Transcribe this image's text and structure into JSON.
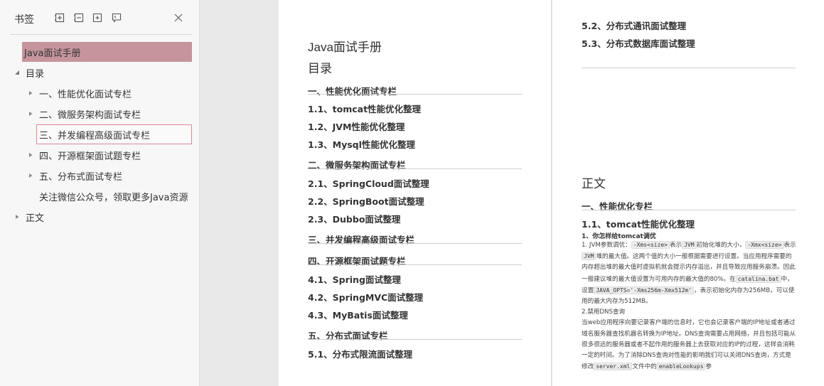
{
  "sidebar": {
    "title": "书签",
    "items": [
      {
        "label": "Java面试手册",
        "expandable": false
      },
      {
        "label": "目录",
        "expandable": true,
        "expanded": true
      },
      {
        "label": "一、性能优化面试专栏",
        "expandable": true,
        "expanded": false
      },
      {
        "label": "二、微服务架构面试专栏",
        "expandable": true,
        "expanded": false
      },
      {
        "label": "三、并发编程高级面试专栏",
        "expandable": false
      },
      {
        "label": "四、开源框架面试题专栏",
        "expandable": true,
        "expanded": false
      },
      {
        "label": "五、分布式面试专栏",
        "expandable": true,
        "expanded": false
      },
      {
        "label": "关注微信公众号，领取更多Java资源",
        "expandable": false
      },
      {
        "label": "正文",
        "expandable": true,
        "expanded": false
      }
    ]
  },
  "left_page": {
    "doc_title": "Java面试手册",
    "toc_title": "目录",
    "entries": [
      {
        "text": "一、性能优化面试专栏"
      },
      {
        "text": "1.1、tomcat性能优化整理"
      },
      {
        "text": "1.2、JVM性能优化整理"
      },
      {
        "text": "1.3、Mysql性能优化整理"
      },
      {
        "text": "二、微服务架构面试专栏"
      },
      {
        "text": "2.1、SpringCloud面试整理"
      },
      {
        "text": "2.2、SpringBoot面试整理"
      },
      {
        "text": "2.3、Dubbo面试整理"
      },
      {
        "text": "三、并发编程高级面试专栏"
      },
      {
        "text": "四、开源框架面试题专栏"
      },
      {
        "text": "4.1、Spring面试整理"
      },
      {
        "text": "4.2、SpringMVC面试整理"
      },
      {
        "text": "4.3、MyBatis面试整理"
      },
      {
        "text": "五、分布式面试专栏"
      },
      {
        "text": "5.1、分布式限流面试整理"
      }
    ]
  },
  "right_page": {
    "toc_continued": [
      "5.2、分布式通讯面试整理",
      "5.3、分布式数据库面试整理"
    ],
    "main_title": "正文",
    "section_heading": "一、性能优化专栏",
    "sub_heading": "1.1、tomcat性能优化整理",
    "q_heading": "1、你怎样给tomcat调优",
    "p1": {
      "a": "1. JVM参数调优：",
      "c1": "-Xms<size>",
      "b": "表示",
      "c2": "JVM",
      "d": "初始化堆的大小，",
      "c3": "-Xmx<size>",
      "e": "表示",
      "c4": "JVM",
      "f": "堆的最大值。这两个值的大小一般根据需要进行设置。当应用程序需要的内存超出堆的最大值时虚拟机就会提示内存溢出，并且导致应用服务崩溃。因此一般建议堆的最大值设置为可用内存的最大值的80%。在",
      "c5": "catalina.bat",
      "g": "中，设置",
      "c6": "JAVA_OPTS='-Xms256m-Xmx512m'",
      "h": "，表示初始化内存为256MB，可以使用的最大内存为512MB。"
    },
    "p2": "2.禁用DNS查询",
    "p3": {
      "a": "当web应用程序向要记录客户端的信息时，它也会记录客户端的IP地址或者通过域名服务器查找机器名转换为IP地址。DNS查询需要占用网络，并且包括可能从很多很远的服务器或者不起作用的服务器上去获取对应的IP的过程，这样会消耗一定的时间。为了消除DNS查询对性能的影响我们可以关闭DNS查询，方式是修改",
      "c1": "server.xml",
      "b": "文件中的",
      "c2": "enableLookups",
      "c": "参"
    }
  }
}
